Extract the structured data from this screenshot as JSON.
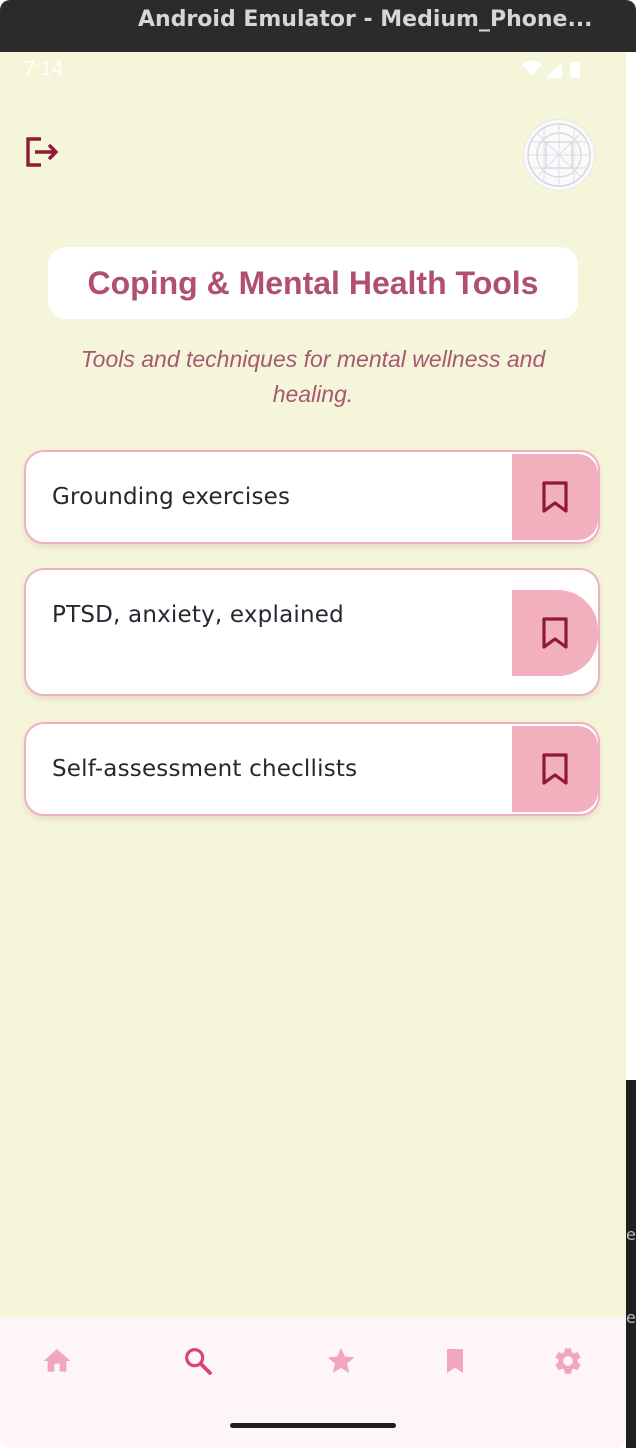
{
  "window": {
    "title": "Android Emulator - Medium_Phone..."
  },
  "status_bar": {
    "time": "7:14"
  },
  "header": {
    "title": "Coping & Mental Health Tools",
    "subtitle": "Tools and techniques for mental wellness and healing."
  },
  "items": [
    {
      "label": "Grounding exercises"
    },
    {
      "label": "PTSD, anxiety, explained"
    },
    {
      "label": "Self-assessment checllists"
    }
  ],
  "nav": [
    {
      "icon": "home-icon"
    },
    {
      "icon": "search-icon",
      "active": true
    },
    {
      "icon": "star-icon"
    },
    {
      "icon": "bookmark-icon"
    },
    {
      "icon": "settings-icon"
    }
  ],
  "colors": {
    "background": "#f5f5da",
    "accent": "#b0506e",
    "bookmark_bg": "#f2afbe",
    "bookmark_icon": "#8e1a33",
    "nav_icon": "#f2a5bf",
    "nav_active": "#d9437a"
  }
}
